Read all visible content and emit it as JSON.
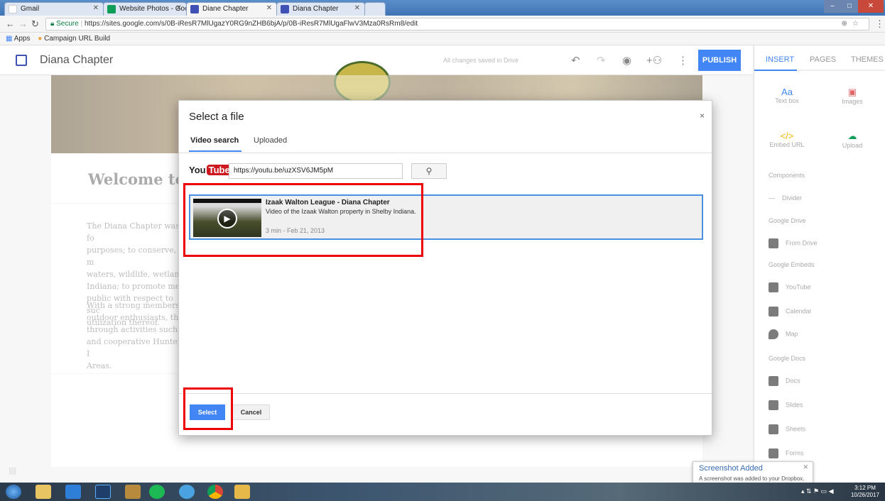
{
  "browser": {
    "tabs": [
      {
        "label": "Gmail"
      },
      {
        "label": "Website Photos - Googl"
      },
      {
        "label": "Diane Chapter"
      },
      {
        "label": "Diana Chapter"
      }
    ],
    "url_secure": "Secure",
    "url": "https://sites.google.com/s/0B-iResR7MlUgazY0RG9nZHB6bjA/p/0B-iResR7MlUgaFlwV3Mza0RsRm8/edit",
    "bookmarks": [
      "Apps",
      "Campaign URL Build"
    ]
  },
  "sites": {
    "title": "Diana Chapter",
    "save_status": "All changes saved in Drive",
    "publish_label": "PUBLISH",
    "panel_tabs": [
      "INSERT",
      "PAGES",
      "THEMES"
    ],
    "insert_items": {
      "text_box": "Text box",
      "images": "Images",
      "embed_url": "Embed URL",
      "upload": "Upload"
    },
    "sections": {
      "components": "Components",
      "divider": "Divider",
      "google_drive": "Google Drive",
      "from_drive": "From Drive",
      "google_embeds": "Google Embeds",
      "youtube": "YouTube",
      "calendar": "Calendar",
      "map": "Map",
      "google_docs": "Google Docs",
      "docs": "Docs",
      "slides": "Slides",
      "sheets": "Sheets",
      "forms": "Forms"
    }
  },
  "page": {
    "welcome": "Welcome to t",
    "para1": [
      "The Diana Chapter was fo",
      "purposes; to conserve, m",
      "waters, wildlife, wetland",
      "Indiana; to promote mea",
      "public with respect to suc",
      "utilization thereof."
    ],
    "para2": [
      "With a strong membersh",
      "outdoor enthusiasts, the",
      "through activities such a",
      "and cooperative Hunter I",
      "Areas."
    ]
  },
  "dialog": {
    "title": "Select a file",
    "close": "×",
    "tabs": [
      "Video search",
      "Uploaded"
    ],
    "logo_you": "You",
    "logo_tube": "Tube",
    "search_value": "https://youtu.be/uzXSV6JM5pM",
    "result": {
      "title": "Izaak Walton League - Diana Chapter",
      "description": "Video of the Izaak Walton property in Shelby Indiana.",
      "meta": "3 min - Feb 21, 2013"
    },
    "select_label": "Select",
    "cancel_label": "Cancel"
  },
  "notification": {
    "title": "Screenshot Added",
    "text": "A screenshot was added to your Dropbox."
  },
  "taskbar": {
    "time": "3:12 PM",
    "date": "10/26/2017"
  },
  "colors": {
    "accent": "#4285f4",
    "annotation": "#ee0000"
  }
}
